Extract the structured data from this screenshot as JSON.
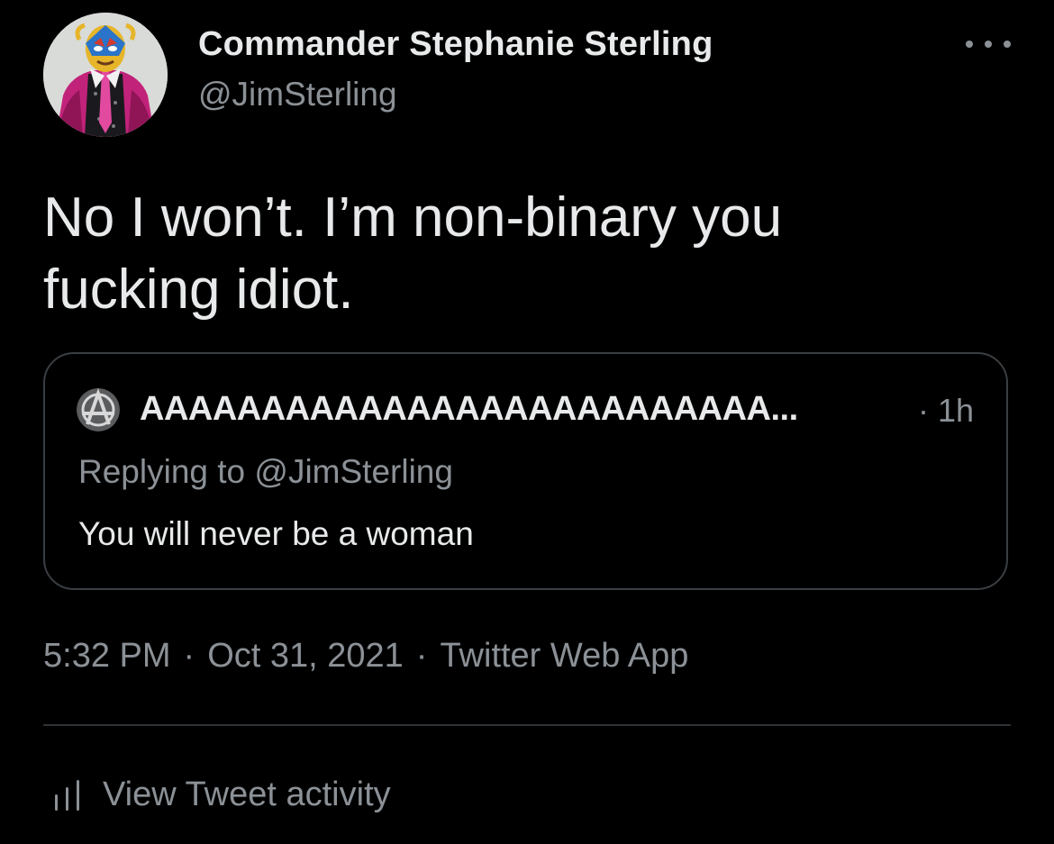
{
  "tweet": {
    "author": {
      "display_name": "Commander Stephanie Sterling",
      "handle": "@JimSterling",
      "avatar_icon": "profile-avatar"
    },
    "text": "No I won’t. I’m non-binary you\nfucking idiot.",
    "quoted_tweet": {
      "author_name": "AAAAAAAAAAAAAAAAAAAAAAAAAA...",
      "time": "· 1h",
      "replying_to": "Replying to @JimSterling",
      "text": "You will never be a woman",
      "avatar_icon": "anarchy-symbol-avatar"
    },
    "meta": {
      "time": "5:32 PM",
      "separator": "·",
      "date": "Oct 31, 2021",
      "source": "Twitter Web App"
    },
    "activity_label": "View Tweet activity"
  },
  "theme": {
    "background": "#000000",
    "text_primary": "#e7e9ea",
    "text_secondary": "#8b9196",
    "border": "#3a3e42",
    "avatar_accent": "#c2237a"
  }
}
